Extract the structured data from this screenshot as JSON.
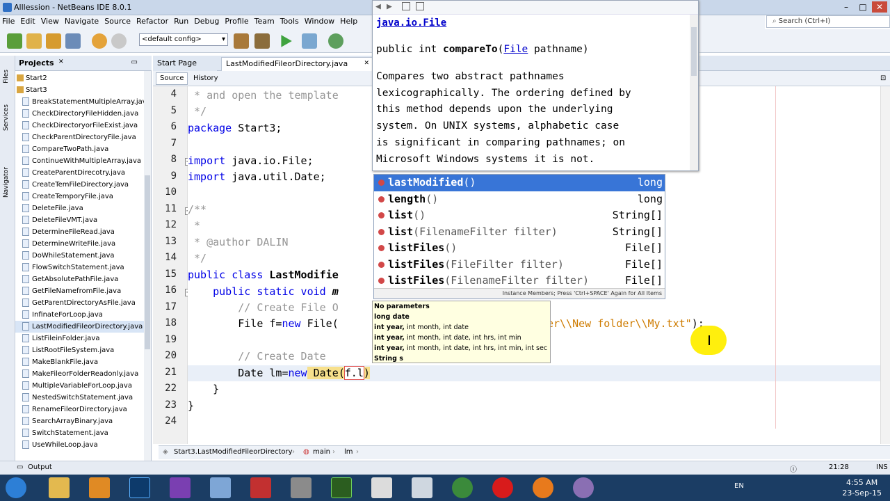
{
  "window": {
    "title": "Alllession - NetBeans IDE 8.0.1"
  },
  "menus": [
    "File",
    "Edit",
    "View",
    "Navigate",
    "Source",
    "Refactor",
    "Run",
    "Debug",
    "Profile",
    "Team",
    "Tools",
    "Window",
    "Help"
  ],
  "toolbar": {
    "config_value": "<default config>"
  },
  "search": {
    "placeholder": "Search (Ctrl+I)"
  },
  "left_strip": {
    "files": "Files",
    "services": "Services",
    "navigator": "Navigator"
  },
  "projects": {
    "tab_label": "Projects",
    "packages": [
      "Start2",
      "Start3"
    ],
    "files": [
      "BreakStatementMultipleArray.java",
      "CheckDirectoryFileHidden.java",
      "CheckDirectoryorFileExist.java",
      "CheckParentDirectoryFile.java",
      "CompareTwoPath.java",
      "ContinueWithMultipleArray.java",
      "CreateParentDirecotry.java",
      "CreateTemFileDirectory.java",
      "CreateTemporyFile.java",
      "DeleteFile.java",
      "DeleteFileVMT.java",
      "DetermineFileRead.java",
      "DetermineWriteFile.java",
      "DoWhileStatement.java",
      "FlowSwitchStatement.java",
      "GetAbsolutePathFile.java",
      "GetFileNamefromFile.java",
      "GetParentDirectoryAsFile.java",
      "InfinateForLoop.java",
      "LastModifiedFileorDirectory.java",
      "ListFileinFolder.java",
      "ListRootFileSystem.java",
      "MakeBlankFile.java",
      "MakeFileorFolderReadonly.java",
      "MultipleVariableForLoop.java",
      "NestedSwitchStatement.java",
      "RenameFileorDirectory.java",
      "SearchArrayBinary.java",
      "SwitchStatement.java",
      "UseWhileLoop.java"
    ],
    "selected_index": 19
  },
  "editor": {
    "tabs": [
      "Start Page",
      "LastModifiedFileorDirectory.java"
    ],
    "source_btn": "Source",
    "history_btn": "History",
    "line_numbers": [
      "4",
      "5",
      "6",
      "7",
      "8",
      "9",
      "10",
      "11",
      "12",
      "13",
      "14",
      "15",
      "16",
      "17",
      "18",
      "19",
      "20",
      "21",
      "22",
      "23",
      "24"
    ],
    "lines": {
      "l4": " * and open the template",
      "l5": " */",
      "l6a": "package",
      "l6b": " Start3;",
      "l8a": "import",
      "l8b": " java.io.File;",
      "l9a": "import",
      "l9b": " java.util.Date;",
      "l11": "/**",
      "l12": " *",
      "l13": " * @author DALIN",
      "l14": " */",
      "l15a": "public class",
      "l15b": " LastModifie",
      "l16a": "    public static void",
      "l16b": " m",
      "l17": "        // Create File O",
      "l18a": "        File f=",
      "l18b": "new",
      "l18c": " File(",
      "l18d": "er\\\\New folder\\\\My.txt\"",
      "l18e": ");",
      "l20": "        // Create Date",
      "l21a": "        Date lm=",
      "l21b": "new",
      "l21c": " Date(",
      "l21d": "f.l",
      "l21e": ")",
      "l22": "    }",
      "l23": "}"
    }
  },
  "javadoc": {
    "class_link": "java.io.File",
    "sig_prefix": "public int ",
    "sig_method": "compareTo",
    "sig_open": "(",
    "sig_type": "File",
    "sig_rest": " pathname)",
    "description_lines": [
      "Compares two abstract pathnames",
      "lexicographically. The ordering defined by",
      "this method depends upon the underlying",
      "system. On UNIX systems, alphabetic case",
      "is significant in comparing pathnames; on",
      "Microsoft Windows systems it is not."
    ]
  },
  "completion": {
    "items": [
      {
        "name": "lastModified",
        "params": "()",
        "ret": "long"
      },
      {
        "name": "length",
        "params": "()",
        "ret": "long"
      },
      {
        "name": "list",
        "params": "()",
        "ret": "String[]"
      },
      {
        "name": "list",
        "params": "(FilenameFilter filter)",
        "ret": "String[]"
      },
      {
        "name": "listFiles",
        "params": "()",
        "ret": "File[]"
      },
      {
        "name": "listFiles",
        "params": "(FileFilter filter)",
        "ret": "File[]"
      },
      {
        "name": "listFiles",
        "params": "(FilenameFilter filter)",
        "ret": "File[]"
      }
    ],
    "selected_index": 0,
    "footer": "Instance Members; Press 'Ctrl+SPACE' Again for All Items"
  },
  "param_tooltip": [
    {
      "bold": "No parameters",
      "rest": ""
    },
    {
      "bold": "long date",
      "rest": ""
    },
    {
      "bold": "int year,",
      "rest": " int month, int date"
    },
    {
      "bold": "int year,",
      "rest": " int month, int date, int hrs, int min"
    },
    {
      "bold": "int year,",
      "rest": " int month, int date, int hrs, int min, int sec"
    },
    {
      "bold": "String s",
      "rest": ""
    }
  ],
  "breadcrumb": {
    "class": "Start3.LastModifiedFileorDirectory",
    "method": "main",
    "var": "lm"
  },
  "status": {
    "output": "Output",
    "position": "21:28",
    "mode": "INS"
  },
  "taskbar": {
    "lang": "EN",
    "time": "4:55 AM",
    "date": "23-Sep-15"
  }
}
